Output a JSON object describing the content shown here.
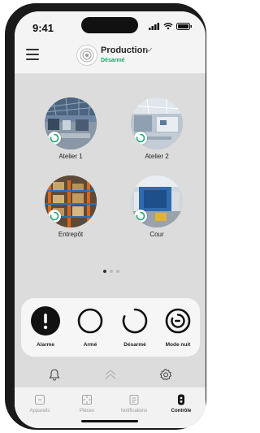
{
  "status_bar": {
    "time": "9:41"
  },
  "header": {
    "site_name": "Production",
    "site_status": "Désarmé",
    "status_color": "#1aa86c"
  },
  "groups": [
    {
      "label": "Atelier 1"
    },
    {
      "label": "Atelier 2"
    },
    {
      "label": "Entrepôt"
    },
    {
      "label": "Cour"
    }
  ],
  "pagination": {
    "pages": 3,
    "current": 1
  },
  "controls": [
    {
      "label": "Alarme",
      "icon": "exclamation-icon"
    },
    {
      "label": "Armé",
      "icon": "armed-ring-icon"
    },
    {
      "label": "Désarmé",
      "icon": "disarmed-open-ring-icon"
    },
    {
      "label": "Mode nuit",
      "icon": "night-mode-icon"
    }
  ],
  "quick_bar": {
    "icons": [
      "bell-icon",
      "chevrons-up-icon",
      "gear-icon"
    ]
  },
  "tabs": [
    {
      "label": "Appareils",
      "icon": "devices-icon",
      "active": false
    },
    {
      "label": "Pièces",
      "icon": "rooms-icon",
      "active": false
    },
    {
      "label": "Notifications",
      "icon": "notifications-icon",
      "active": false
    },
    {
      "label": "Contrôle",
      "icon": "control-icon",
      "active": true
    }
  ]
}
